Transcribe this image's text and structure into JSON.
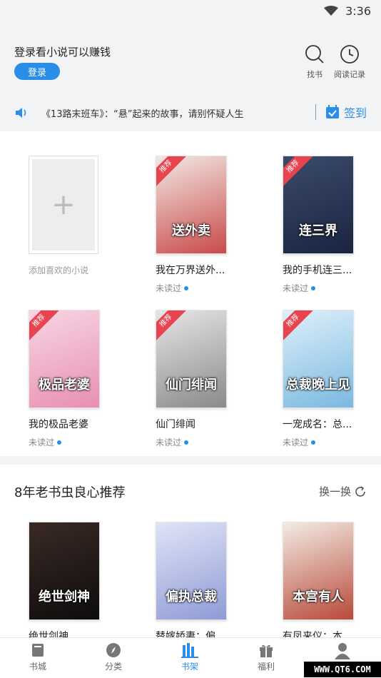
{
  "status_bar": {
    "time": "3:36"
  },
  "header": {
    "login_prompt": "登录看小说可以赚钱",
    "login_button": "登录",
    "find_books_label": "找书",
    "reading_history_label": "阅读记录"
  },
  "notice": {
    "text": "《13路末班车》：“悬”起来的故事，请别怀疑人生",
    "sign_in_label": "签到"
  },
  "shelf": {
    "add_label": "添加喜欢的小说",
    "recommend_tag": "推荐",
    "books": [
      {
        "title": "我在万界送外...",
        "status": "未读过",
        "cover_text": "送外卖",
        "cover_colors": [
          "#f2e9e4",
          "#c94a4a"
        ]
      },
      {
        "title": "我的手机连三...",
        "status": "未读过",
        "cover_text": "连三界",
        "cover_colors": [
          "#3b4b6b",
          "#1a2440"
        ]
      },
      {
        "title": "我的极品老婆",
        "status": "未读过",
        "cover_text": "极品老婆",
        "cover_colors": [
          "#f7d6e4",
          "#e88fb2"
        ]
      },
      {
        "title": "仙门绯闻",
        "status": "未读过",
        "cover_text": "仙门绯闻",
        "cover_colors": [
          "#e6e6e6",
          "#8a8a8a"
        ]
      },
      {
        "title": "一宠成名：总...",
        "status": "未读过",
        "cover_text": "总裁晚上见",
        "cover_colors": [
          "#dff0fa",
          "#7ab9e0"
        ]
      }
    ]
  },
  "recommend": {
    "title": "8年老书虫良心推荐",
    "refresh_label": "换一换",
    "books": [
      {
        "title": "绝世剑神",
        "cover_text": "绝世剑神",
        "cover_colors": [
          "#3a2a26",
          "#0e0c0c"
        ]
      },
      {
        "title": "替嫁娇妻：偏...",
        "cover_text": "偏执总裁",
        "cover_colors": [
          "#e0e4f6",
          "#8f9bd6"
        ]
      },
      {
        "title": "有凤来仪：本...",
        "cover_text": "本宫有人",
        "cover_colors": [
          "#f3ece4",
          "#b84a3a"
        ]
      }
    ]
  },
  "tabs": [
    {
      "label": "书城",
      "icon": "book-icon"
    },
    {
      "label": "分类",
      "icon": "compass-icon"
    },
    {
      "label": "书架",
      "icon": "shelf-icon"
    },
    {
      "label": "福利",
      "icon": "gift-icon"
    },
    {
      "label": "",
      "icon": "user-icon"
    }
  ],
  "watermark": "WWW.QT6.COM",
  "colors": {
    "accent": "#2a8ee8",
    "ribbon": "#e8434f",
    "background": "#f2f3f5"
  }
}
